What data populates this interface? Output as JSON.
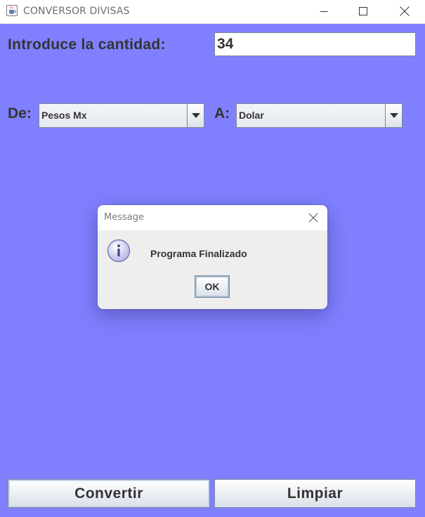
{
  "window": {
    "title": "CONVERSOR DIVISAS",
    "icon": "java-cup-icon"
  },
  "colors": {
    "background": "#8080ff",
    "text": "#333333",
    "title_text": "#6e6e6e"
  },
  "form": {
    "amount_label": "Introduce la cantidad:",
    "amount_value": "34",
    "from_label": "De:",
    "from_value": "Pesos Mx",
    "to_label": "A:",
    "to_value": "Dolar"
  },
  "buttons": {
    "convert": "Convertir",
    "clear": "Limpiar"
  },
  "dialog": {
    "title": "Message",
    "icon": "information-icon",
    "message": "Programa Finalizado",
    "ok": "OK"
  }
}
